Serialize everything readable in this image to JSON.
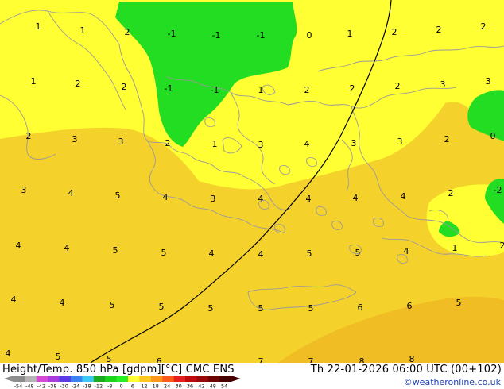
{
  "map": {
    "colors": {
      "band_0_4": "#ffff33",
      "band_4_8": "#f5d22b",
      "band_8_12": "#f0bd24",
      "band_minus4_0": "#22dd22",
      "coast": "#9a9a9a",
      "contour": "#000000"
    },
    "value_labels": [
      "1",
      "1",
      "2",
      "-1",
      "-1",
      "-1",
      "0",
      "1",
      "2",
      "2",
      "2",
      "1",
      "2",
      "2",
      "-1",
      "-1",
      "1",
      "2",
      "2",
      "2",
      "3",
      "3",
      "2",
      "3",
      "3",
      "2",
      "1",
      "3",
      "4",
      "3",
      "3",
      "2",
      "0",
      "3",
      "4",
      "5",
      "4",
      "3",
      "4",
      "4",
      "4",
      "4",
      "2",
      "-2",
      "4",
      "4",
      "5",
      "5",
      "4",
      "4",
      "5",
      "5",
      "4",
      "1",
      "2",
      "4",
      "4",
      "5",
      "5",
      "5",
      "5",
      "5",
      "6",
      "6",
      "5",
      "4",
      "5",
      "5",
      "6",
      "7",
      "7",
      "8",
      "8"
    ]
  },
  "footer": {
    "title": "Height/Temp. 850 hPa [gdpm][°C] CMC ENS",
    "valid": "Th 22-01-2026 06:00 UTC (00+102)",
    "credit": "©weatheronline.co.uk"
  },
  "legend": {
    "ticks": [
      "-54",
      "-48",
      "-42",
      "-38",
      "-30",
      "-24",
      "-18",
      "-12",
      "-8",
      "0",
      "6",
      "12",
      "18",
      "24",
      "30",
      "36",
      "42",
      "48",
      "54"
    ],
    "colors": [
      "#8c8c8c",
      "#b4b4b4",
      "#d24bd2",
      "#aa3cdc",
      "#5a3ce6",
      "#3c82f0",
      "#3cc8f0",
      "#1eaa1e",
      "#1ed21e",
      "#28f028",
      "#ffff32",
      "#ffc81e",
      "#ff961e",
      "#ff5a1e",
      "#e61e1e",
      "#be0a0a",
      "#960a0a",
      "#6e0505",
      "#460000"
    ]
  }
}
